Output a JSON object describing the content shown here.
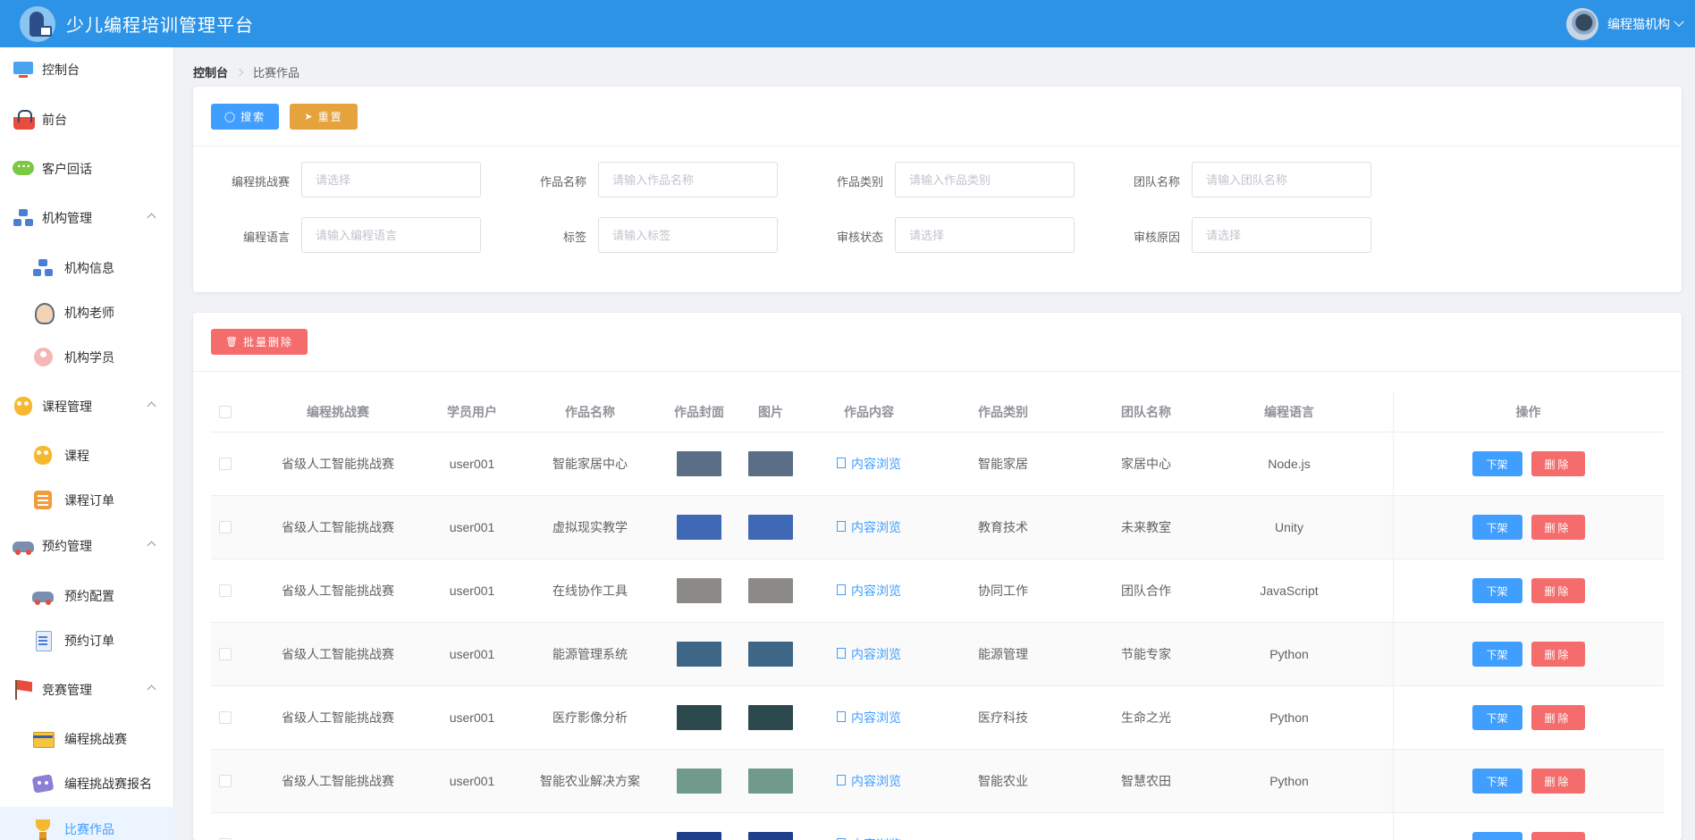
{
  "app": {
    "title": "少儿编程培训管理平台",
    "user": "编程猫机构"
  },
  "sidebar": {
    "items": [
      {
        "label": "控制台",
        "icon": "monitor-icon",
        "level": 0
      },
      {
        "label": "前台",
        "icon": "basket-icon",
        "level": 0
      },
      {
        "label": "客户回话",
        "icon": "chat-icon",
        "level": 0
      },
      {
        "label": "机构管理",
        "icon": "org-icon",
        "level": 0,
        "expanded": true
      },
      {
        "label": "机构信息",
        "icon": "org-icon",
        "level": 1
      },
      {
        "label": "机构老师",
        "icon": "teacher-icon",
        "level": 1
      },
      {
        "label": "机构学员",
        "icon": "student-icon",
        "level": 1
      },
      {
        "label": "课程管理",
        "icon": "owl-icon",
        "level": 0,
        "expanded": true
      },
      {
        "label": "课程",
        "icon": "owl-icon",
        "level": 1
      },
      {
        "label": "课程订单",
        "icon": "list-icon",
        "level": 1
      },
      {
        "label": "预约管理",
        "icon": "car-icon",
        "level": 0,
        "expanded": true
      },
      {
        "label": "预约配置",
        "icon": "car-icon",
        "level": 1
      },
      {
        "label": "预约订单",
        "icon": "doc-icon",
        "level": 1
      },
      {
        "label": "竞赛管理",
        "icon": "flag-icon",
        "level": 0,
        "expanded": true
      },
      {
        "label": "编程挑战赛",
        "icon": "card-icon",
        "level": 1
      },
      {
        "label": "编程挑战赛报名",
        "icon": "mask-icon",
        "level": 1
      },
      {
        "label": "比赛作品",
        "icon": "trophy-icon",
        "level": 1,
        "active": true
      }
    ]
  },
  "breadcrumb": {
    "home": "控制台",
    "current": "比赛作品"
  },
  "toolbar": {
    "search_label": "搜索",
    "reset_label": "重置",
    "batch_delete_label": "批量删除"
  },
  "filters": [
    {
      "label": "编程挑战赛",
      "placeholder": "请选择"
    },
    {
      "label": "作品名称",
      "placeholder": "请输入作品名称"
    },
    {
      "label": "作品类别",
      "placeholder": "请输入作品类别"
    },
    {
      "label": "团队名称",
      "placeholder": "请输入团队名称"
    },
    {
      "label": "编程语言",
      "placeholder": "请输入编程语言"
    },
    {
      "label": "标签",
      "placeholder": "请输入标签"
    },
    {
      "label": "审核状态",
      "placeholder": "请选择"
    },
    {
      "label": "审核原因",
      "placeholder": "请选择"
    }
  ],
  "table": {
    "columns": [
      "编程挑战赛",
      "学员用户",
      "作品名称",
      "作品封面",
      "图片",
      "作品内容",
      "作品类别",
      "团队名称",
      "编程语言",
      "操作"
    ],
    "content_link": "内容浏览",
    "off_shelf_label": "下架",
    "delete_label": "删除",
    "rows": [
      {
        "contest": "省级人工智能挑战赛",
        "user": "user001",
        "name": "智能家居中心",
        "category": "智能家居",
        "team": "家居中心",
        "lang": "Node.js",
        "thumb": "#5a6e86"
      },
      {
        "contest": "省级人工智能挑战赛",
        "user": "user001",
        "name": "虚拟现实教学",
        "category": "教育技术",
        "team": "未来教室",
        "lang": "Unity",
        "thumb": "#3f68b5"
      },
      {
        "contest": "省级人工智能挑战赛",
        "user": "user001",
        "name": "在线协作工具",
        "category": "协同工作",
        "team": "团队合作",
        "lang": "JavaScript",
        "thumb": "#8c8a86"
      },
      {
        "contest": "省级人工智能挑战赛",
        "user": "user001",
        "name": "能源管理系统",
        "category": "能源管理",
        "team": "节能专家",
        "lang": "Python",
        "thumb": "#3e6687"
      },
      {
        "contest": "省级人工智能挑战赛",
        "user": "user001",
        "name": "医疗影像分析",
        "category": "医疗科技",
        "team": "生命之光",
        "lang": "Python",
        "thumb": "#2c4a4e"
      },
      {
        "contest": "省级人工智能挑战赛",
        "user": "user001",
        "name": "智能农业解决方案",
        "category": "智能农业",
        "team": "智慧农田",
        "lang": "Python",
        "thumb": "#6f9a8c"
      },
      {
        "contest": "",
        "user": "",
        "name": "",
        "category": "",
        "team": "",
        "lang": "",
        "thumb": "#1f3f8a"
      }
    ]
  },
  "colors": {
    "header": "#2d93e6",
    "primary": "#409eff",
    "warning": "#e6a23c",
    "danger": "#f56c6c"
  }
}
